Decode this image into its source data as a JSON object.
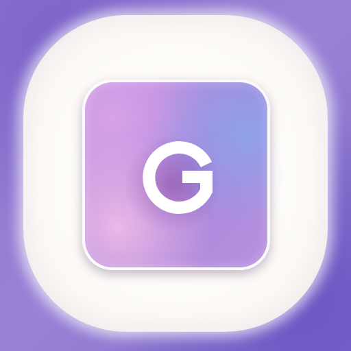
{
  "icon": {
    "letter": "G",
    "name": "g-app-icon"
  },
  "colors": {
    "background": "#8d74cf",
    "outer_plate": "#fdfbf8",
    "tile_pink": "#ecb8e6",
    "tile_blue": "#8fa2e8",
    "tile_purple": "#a784dc",
    "glyph": "#ffffff"
  }
}
